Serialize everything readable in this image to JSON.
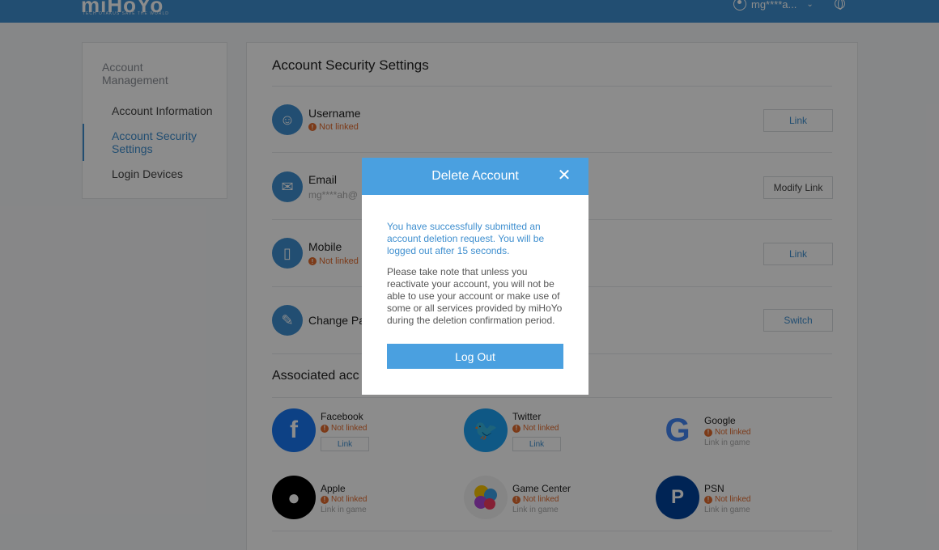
{
  "header": {
    "logo": "miHoYo",
    "logo_tagline": "TECH OTAKUS SAVE THE WORLD",
    "user": "mg****a...",
    "colors": {
      "bar": "#3f8fcf"
    }
  },
  "sidebar": {
    "heading": "Account Management",
    "items": [
      {
        "label": "Account Information",
        "active": false
      },
      {
        "label": "Account Security Settings",
        "active": true
      },
      {
        "label": "Login Devices",
        "active": false
      }
    ]
  },
  "main": {
    "title": "Account Security Settings",
    "rows": [
      {
        "label": "Username",
        "status": "Not linked",
        "button": "Link",
        "icon": "face-icon"
      },
      {
        "label": "Email",
        "sub": "mg****ah@",
        "button": "Modify Link",
        "icon": "mail-icon"
      },
      {
        "label": "Mobile",
        "status": "Not linked",
        "button": "Link",
        "icon": "phone-icon"
      },
      {
        "label": "Change Pas",
        "button": "Switch",
        "icon": "pencil-icon"
      }
    ],
    "associated_title": "Associated acc",
    "social": [
      {
        "name": "Facebook",
        "status": "Not linked",
        "button": "Link",
        "icon": "facebook-icon"
      },
      {
        "name": "Twitter",
        "status": "Not linked",
        "button": "Link",
        "icon": "twitter-icon"
      },
      {
        "name": "Google",
        "status": "Not linked",
        "sub": "Link in game",
        "icon": "google-icon"
      },
      {
        "name": "Apple",
        "status": "Not linked",
        "sub": "Link in game",
        "icon": "apple-icon"
      },
      {
        "name": "Game Center",
        "status": "Not linked",
        "sub": "Link in game",
        "icon": "game-center-icon"
      },
      {
        "name": "PSN",
        "status": "Not linked",
        "sub": "Link in game",
        "icon": "psn-icon"
      }
    ]
  },
  "modal": {
    "title": "Delete Account",
    "close": "✕",
    "message": "You have successfully submitted an account deletion request. You will be logged out after 15 seconds.",
    "note": "Please take note that unless you reactivate your account, you will not be able to use your account or make use of some or all services provided by miHoYo during the deletion confirmation period.",
    "button": "Log Out"
  }
}
